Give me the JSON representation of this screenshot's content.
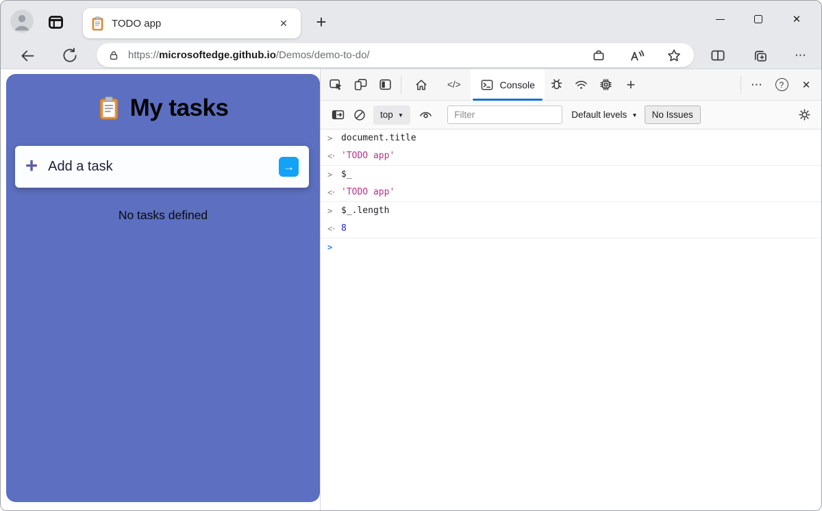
{
  "glyphs": {
    "new_tab": "+",
    "tab_close": "✕",
    "window_close": "✕",
    "dt_close": "✕",
    "more_tabs": "⋯",
    "more_menu": "⋯",
    "help": "?",
    "code_tab": "</>",
    "caret_down": "▼",
    "plus": "+",
    "arrow": "→",
    "add_tool_plus": "+"
  },
  "browser": {
    "tab_title": "TODO app",
    "url_scheme": "https://",
    "url_domain": "microsoftedge.github.io",
    "url_path": "/Demos/demo-to-do/"
  },
  "app": {
    "title": "My tasks",
    "add_task_label": "Add a task",
    "empty_message": "No tasks defined",
    "colors": {
      "background": "#5c6fc0",
      "submit_blue": "#12a2f7",
      "plus_purple": "#5e5caa"
    }
  },
  "devtools": {
    "console_tab_label": "Console",
    "toolbar": {
      "context_selector": "top",
      "filter_placeholder": "Filter",
      "levels_label": "Default levels",
      "no_issues_label": "No Issues"
    },
    "console": {
      "input_chevron": ">",
      "result_chevron": "<·",
      "prompt_chevron": ">",
      "entries": [
        {
          "input": "document.title",
          "result": "'TODO app'",
          "result_type": "string"
        },
        {
          "input": "$_",
          "result": "'TODO app'",
          "result_type": "string"
        },
        {
          "input": "$_.length",
          "result": "8",
          "result_type": "number"
        }
      ]
    },
    "colors": {
      "active_tab_underline": "#1672d3",
      "string_value": "#b3338c",
      "number_value": "#2726cc",
      "prompt_blue": "#2b7ef0"
    }
  }
}
